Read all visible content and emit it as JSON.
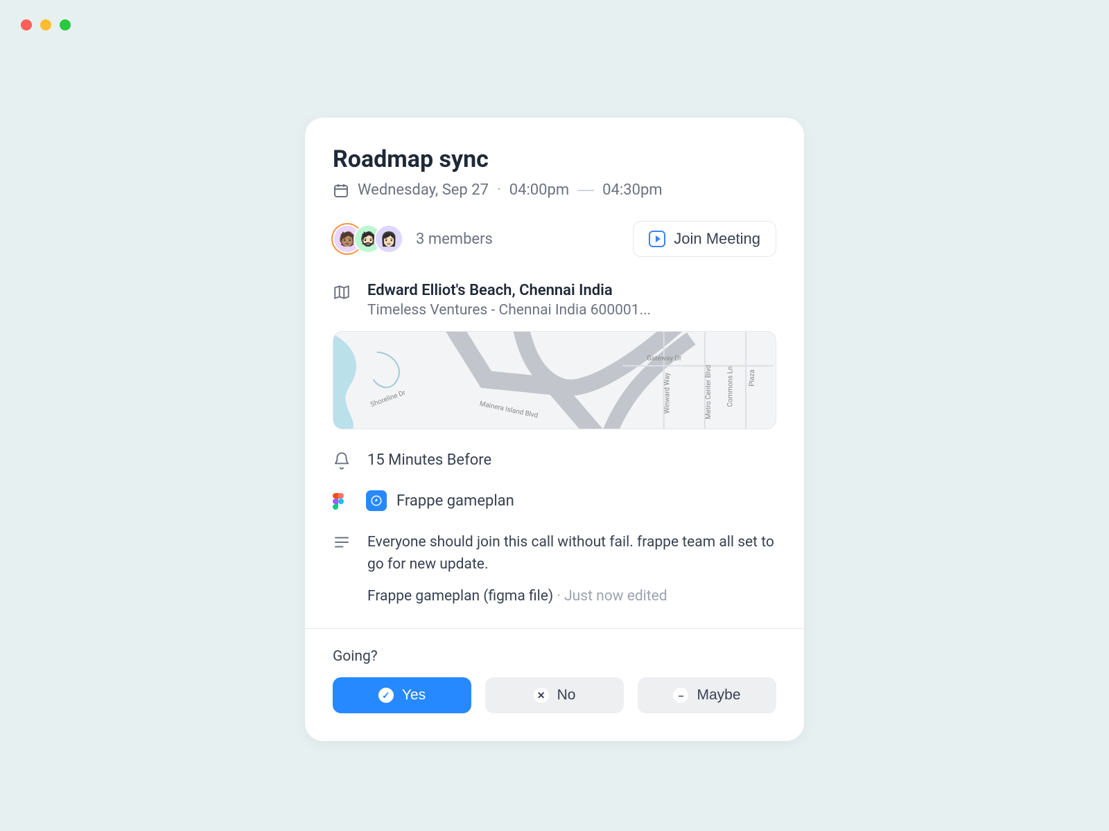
{
  "event": {
    "title": "Roadmap sync",
    "date": "Wednesday, Sep 27",
    "start_time": "04:00pm",
    "end_time": "04:30pm",
    "members_label": "3 members",
    "join_button": "Join Meeting",
    "location": {
      "name": "Edward Elliot's Beach, Chennai India",
      "address": "Timeless Ventures - Chennai India 600001..."
    },
    "reminder": "15 Minutes Before",
    "attachment_name": "Frappe gameplan",
    "description": "Everyone should join this call without fail. frappe team all set to go for new update.",
    "file": {
      "name": "Frappe gameplan (figma file)",
      "separator": " · ",
      "status": "Just now edited"
    }
  },
  "rsvp": {
    "prompt": "Going?",
    "yes": "Yes",
    "no": "No",
    "maybe": "Maybe"
  },
  "map_labels": {
    "shoreline": "Shoreline Dr",
    "mainera": "Mainera Island Blvd",
    "gateway": "Gateway Dr",
    "winward": "Winward Way",
    "metro": "Metro Center Blvd",
    "commons": "Commons Ln",
    "plaza": "Plaza"
  }
}
